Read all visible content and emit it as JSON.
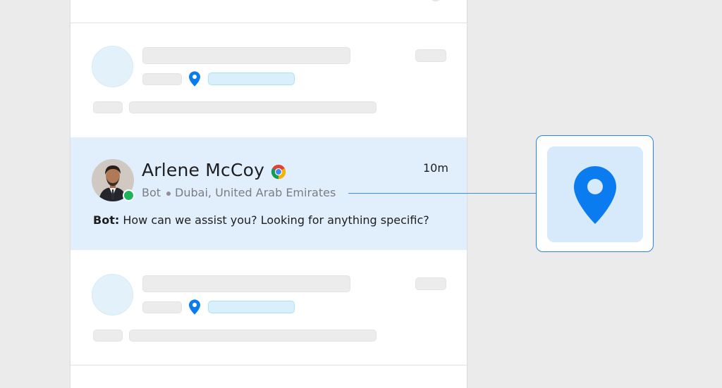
{
  "conversation": {
    "name": "Arlene McCoy",
    "time": "10m",
    "source": "Bot",
    "location": "Dubai, United Arab Emirates",
    "message_sender": "Bot:",
    "message_text": " How can we assist you? Looking for anything specific?",
    "browser_icon": "chrome-icon",
    "status": "online"
  },
  "colors": {
    "accent": "#0a7cf0",
    "active_row": "#e1effc",
    "online": "#1fb45c",
    "callout_border": "#2a84e6"
  },
  "icons": {
    "location": "map-pin-icon"
  }
}
